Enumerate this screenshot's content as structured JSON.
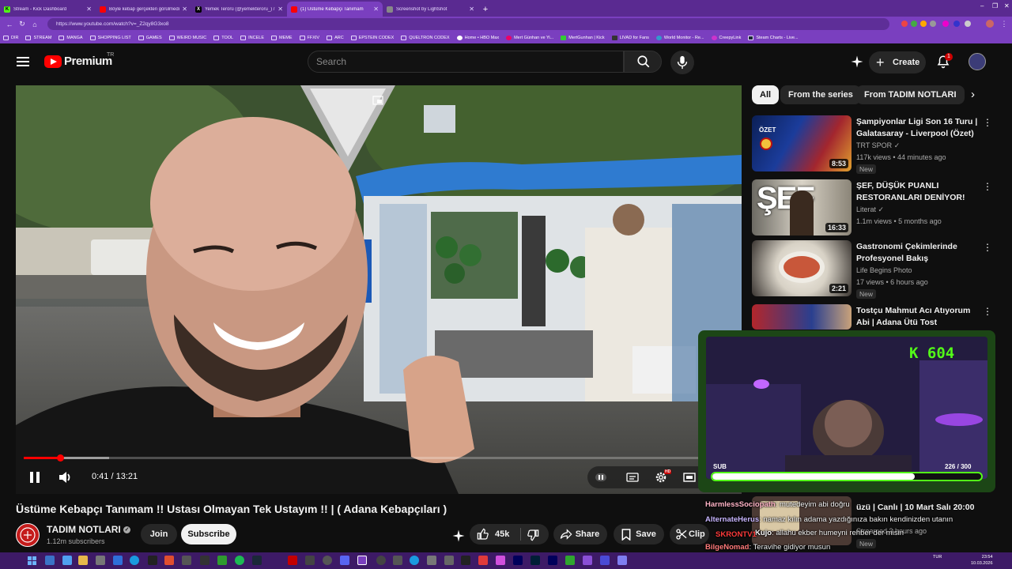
{
  "browser": {
    "tabs": [
      {
        "label": "Stream - Kick Dashboard",
        "favicon": "kick-icon",
        "color": "#53fc18"
      },
      {
        "label": "Böyle kebap gerçekten görülmedi",
        "favicon": "youtube-icon",
        "color": "#ff0000"
      },
      {
        "label": "Yemek Terörü (@yemekteroru_) / X",
        "favicon": "x-icon",
        "color": "#000000"
      },
      {
        "label": "(1) Üstüme Kebapçı Tanımam",
        "favicon": "youtube-icon",
        "color": "#ff0000",
        "active": true
      },
      {
        "label": "Screenshot by Lightshot",
        "favicon": "lightshot-icon",
        "color": "#888888"
      }
    ],
    "new_tab": "+",
    "window_controls": [
      "–",
      "❐",
      "✕"
    ],
    "url": "https://www.youtube.com/watch?v=_Z2qy8G3xo8",
    "bookmarks": [
      "DIR",
      "STREAM",
      "MANGA",
      "SHOPPING LIST",
      "GAMES",
      "WEIRD MUSIC",
      "TOOL",
      "INCELE",
      "MEME",
      "FFXIV",
      "ARC",
      "EPSTEIN CODEX",
      "QUELTRON CODEX",
      "Home • HBO Max",
      "Mert Günhan ve Yi...",
      "MertGunhan | Kick",
      "LIVAD for Fans",
      "World Monitor - Re...",
      "CreepyLink",
      "Steam Charts - Live..."
    ]
  },
  "header": {
    "brand": "Premium",
    "country": "TR",
    "search_placeholder": "Search",
    "create_label": "Create",
    "notification_count": "1"
  },
  "player": {
    "current_time": "0:41",
    "separator": "/",
    "duration": "13:21",
    "progress": 0.051,
    "buffered": 0.12,
    "hd_badge": "HD"
  },
  "video": {
    "title": "Üstüme Kebapçı Tanımam !! Ustası Olmayan Tek Ustayım !! | ( Adana Kebapçıları )",
    "channel_name": "TADIM NOTLARI",
    "subscribers": "1.12m subscribers",
    "join_label": "Join",
    "subscribe_label": "Subscribe",
    "likes": "45k",
    "share_label": "Share",
    "save_label": "Save",
    "clip_label": "Clip"
  },
  "sidebar": {
    "chips": [
      {
        "label": "All",
        "active": true
      },
      {
        "label": "From the series",
        "active": false
      },
      {
        "label": "From TADIM NOTLARI",
        "active": false
      }
    ],
    "recommendations": [
      {
        "title": "Şampiyonlar Ligi Son 16 Turu | Galatasaray - Liverpool (Özet)",
        "channel": "TRT SPOR",
        "meta": "117k views • 44 minutes ago",
        "duration": "8:53",
        "badge": "New",
        "thumb_label": "ÖZET"
      },
      {
        "title": "ŞEF, DÜŞÜK PUANLI RESTORANLARI DENİYOR!",
        "channel": "Literat",
        "meta": "1.1m views • 5 months ago",
        "duration": "16:33",
        "thumb_label": "ŞEF"
      },
      {
        "title": "Gastronomi Çekimlerinde Profesyonel Bakış",
        "channel": "Life Begins Photo",
        "meta": "17 views • 6 hours ago",
        "duration": "2:21",
        "badge": "New"
      },
      {
        "title": "Tostçu Mahmut Acı Atıyorum Abi | Adana Ütü Tost",
        "channel": "",
        "meta": ""
      }
    ],
    "partial_item": {
      "title": "üzü | Canlı | 10 Mart Salı 20:00",
      "meta": "Streamed 3 hours ago",
      "badge": "New"
    }
  },
  "overlay": {
    "follower_count": "K 604",
    "sub_label": "SUB",
    "sub_current": "226",
    "sub_goal": "300",
    "sub_separator": "/",
    "sub_fraction": 0.753
  },
  "chat": [
    {
      "user": "HarmlessSociopath",
      "message": ": mutedeyim abi doğru",
      "color": "#ffb3c6"
    },
    {
      "user": "AlternateHerus",
      "message": ": namaz kılın adama yazdığınıza bakın kendinizden utanın",
      "color": "#c8b6ff"
    },
    {
      "user": "Kujo",
      "message": ": allahu ekber humeyni rehber der misin",
      "color": "#ffffff"
    },
    {
      "user": "SKRONTV1",
      "message": "",
      "color": "#ff3b3b"
    },
    {
      "user": "BilgeNomad",
      "message": ": Teravihe gidiyor musun",
      "color": "#ff7a7a"
    }
  ],
  "taskbar": {
    "language": "TUR",
    "time": "23:54",
    "date": "10.03.2026"
  },
  "colors": {
    "accent": "#ff0000",
    "kick_green": "#53fc18",
    "browser_purple": "#7a3fbf"
  }
}
